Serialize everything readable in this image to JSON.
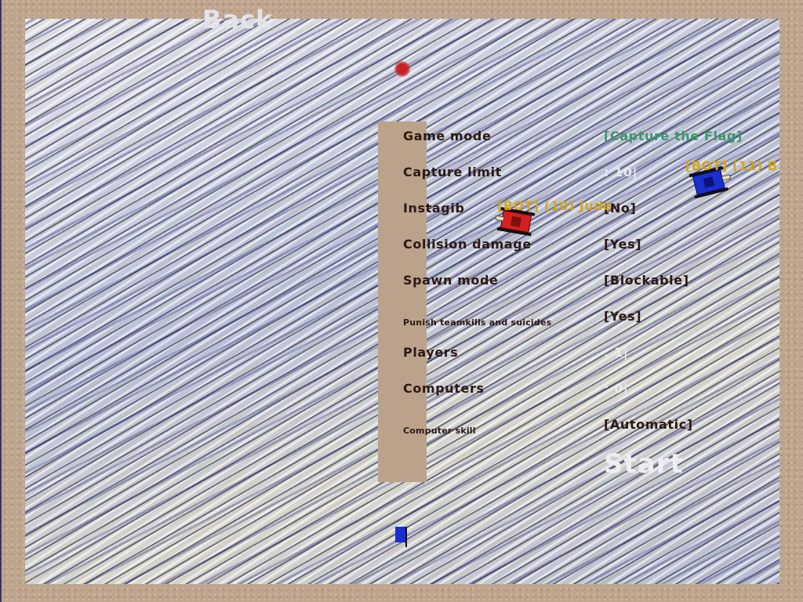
{
  "back_label": "Back",
  "settings": [
    {
      "label": "Game mode",
      "value": "[Capture the Flag]"
    },
    {
      "label": "Capture limit",
      "value": ": 10|"
    },
    {
      "label": "Instagib",
      "value": "[No]"
    },
    {
      "label": "Collision damage",
      "value": "[Yes]"
    },
    {
      "label": "Spawn mode",
      "value": "[Blockable]"
    },
    {
      "label": "Punish teamkills and suicides",
      "value": "[Yes]"
    },
    {
      "label": "Players",
      "value": ": 1|"
    },
    {
      "label": "Computers",
      "value": ": 0|"
    },
    {
      "label": "Computer skill",
      "value": "[Automatic]"
    }
  ],
  "start_label": "Start",
  "bots": [
    {
      "name": "[BOT] (10) Jude",
      "team": "red"
    },
    {
      "name": "[BOT] (12) B",
      "team": "blue"
    }
  ],
  "colors": {
    "label": "#2b1913",
    "game_mode_value": "#3a9a6a",
    "bot_name": "#d6a31a",
    "red_team": "#d42020",
    "blue_team": "#1a2fd0"
  }
}
